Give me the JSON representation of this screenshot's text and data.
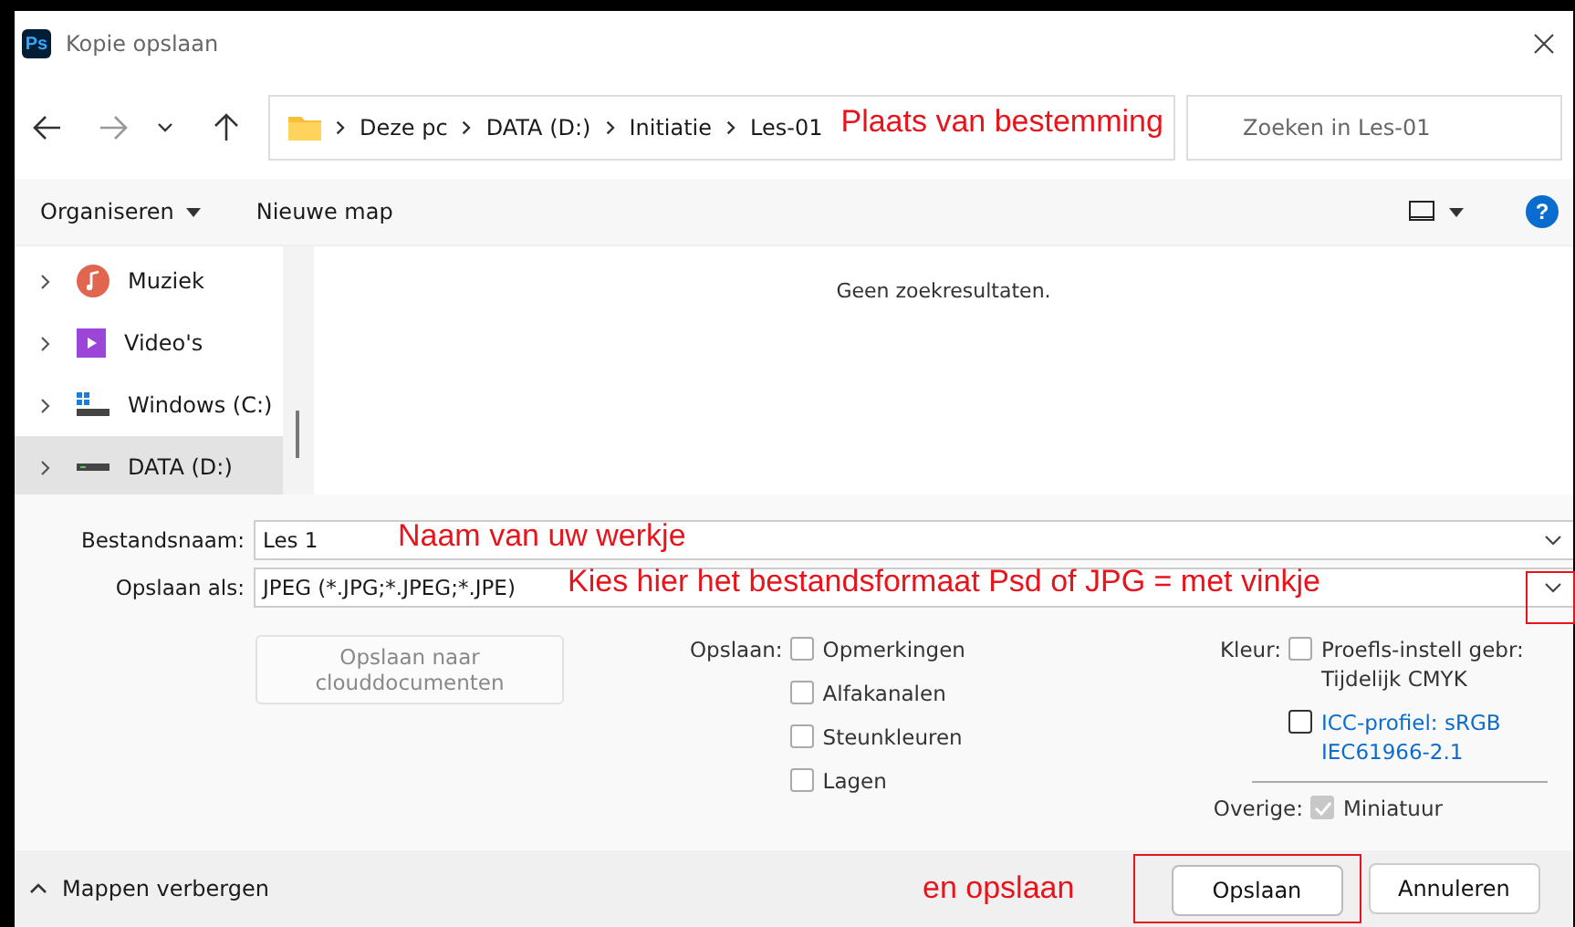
{
  "window": {
    "title": "Kopie opslaan",
    "app_icon": "Ps"
  },
  "address_bar": {
    "path": [
      "Deze pc",
      "DATA (D:)",
      "Initiatie",
      "Les-01"
    ],
    "annotation": "Plaats van bestemming"
  },
  "search": {
    "placeholder": "Zoeken in Les-01"
  },
  "toolbar": {
    "items": [
      "Organiseren",
      "Nieuwe map"
    ],
    "help_icon": "?"
  },
  "sidebar": {
    "items": [
      {
        "label": "Muziek",
        "kind": "music",
        "selected": false
      },
      {
        "label": "Video's",
        "kind": "video",
        "selected": false
      },
      {
        "label": "Windows (C:)",
        "kind": "system-drive",
        "selected": false
      },
      {
        "label": "DATA (D:)",
        "kind": "drive",
        "selected": true
      }
    ]
  },
  "content": {
    "message": "Geen zoekresultaten."
  },
  "form": {
    "filename_label": "Bestandsnaam:",
    "filename": "Les 1",
    "filename_annotation": "Naam van uw werkje",
    "type_label": "Opslaan als:",
    "type_value": "JPEG (*.JPG;*.JPEG;*.JPE)",
    "type_annotation": "Kies hier het bestandsformaat Psd of JPG = met vinkje",
    "type_highlighted": true
  },
  "cloud_button": {
    "label": "Opslaan naar clouddocumenten",
    "disabled": true
  },
  "save_options": {
    "label": "Opslaan:",
    "items": [
      {
        "label": "Opmerkingen",
        "checked": false
      },
      {
        "label": "Alfakanalen",
        "checked": false
      },
      {
        "label": "Steunkleuren",
        "checked": false
      },
      {
        "label": "Lagen",
        "checked": false
      }
    ]
  },
  "color_options": {
    "label": "Kleur:",
    "items": [
      {
        "label": "Proefls-instell gebr: Tijdelijk CMYK",
        "kind": "plain",
        "checked": false
      },
      {
        "label": "ICC-profiel:  sRGB IEC61966-2.1",
        "kind": "link",
        "checked": false
      }
    ]
  },
  "other_options": {
    "label": "Overige:",
    "items": [
      {
        "label": "Miniatuur",
        "checked": true,
        "disabled": true
      }
    ]
  },
  "footer": {
    "toggle": "Mappen verbergen",
    "annotation": "en opslaan",
    "buttons": [
      {
        "label": "Opslaan",
        "kind": "primary",
        "highlighted": true
      },
      {
        "label": "Annuleren",
        "kind": "secondary",
        "highlighted": false
      }
    ]
  }
}
